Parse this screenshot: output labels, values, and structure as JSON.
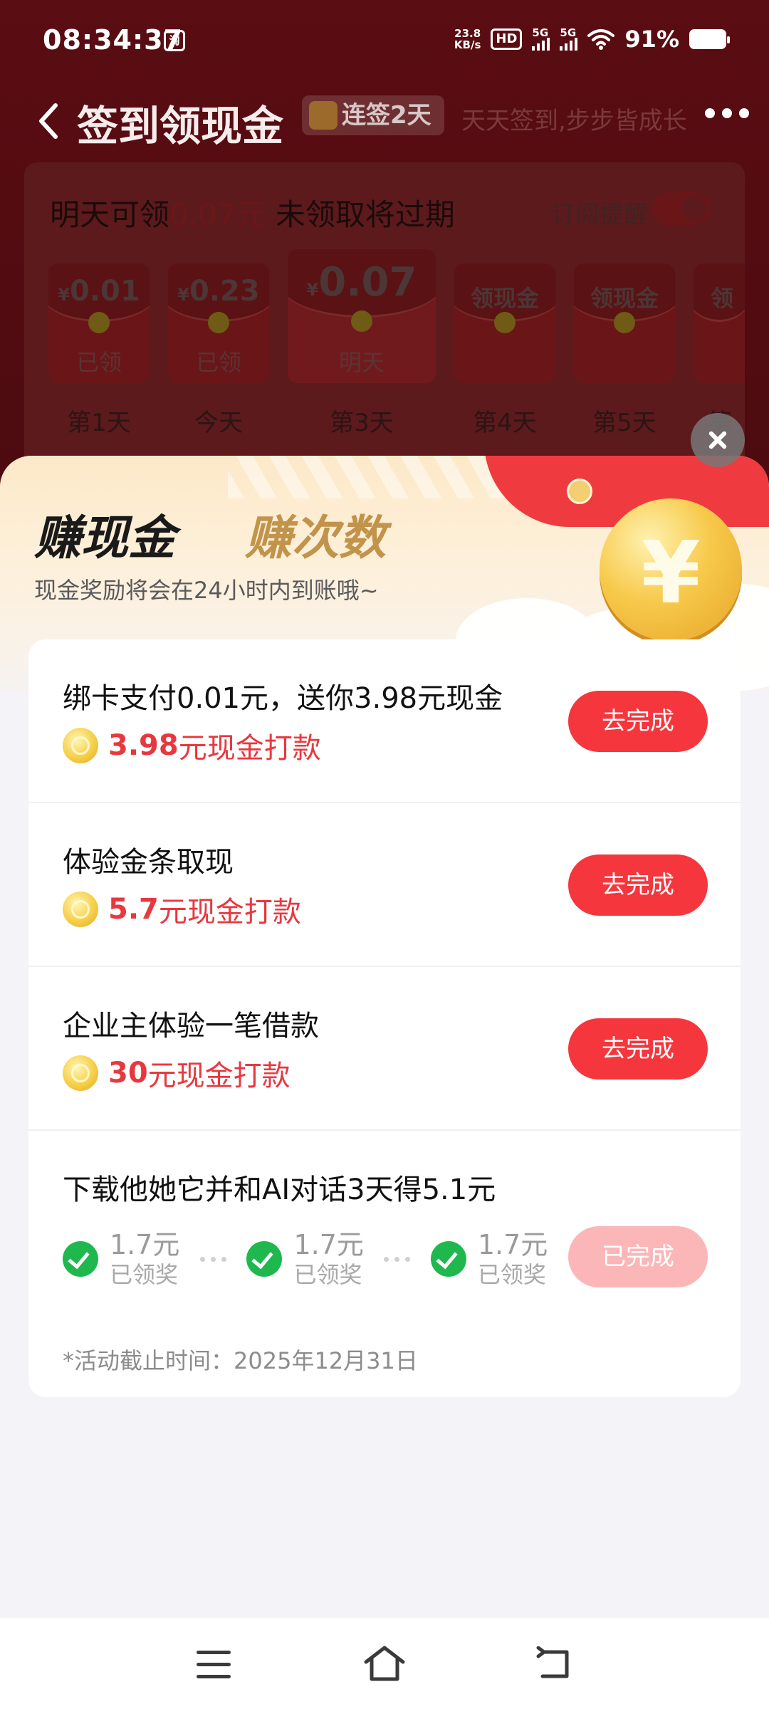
{
  "status_bar": {
    "time": "08:34:37",
    "app_badge": "淘",
    "net_speed_value": "23.8",
    "net_speed_unit": "KB/s",
    "hd_label": "HD",
    "sim1": "5G",
    "sim2": "5G",
    "battery": "91%"
  },
  "header": {
    "title": "签到领现金",
    "streak_badge": "连签2天",
    "slogan": "天天签到,步步皆成长"
  },
  "checkin": {
    "notice_prefix": "明天可领",
    "notice_amount": "0.07元",
    "notice_suffix": " 未领取将过期",
    "subscribe_label": "订阅提醒",
    "subscribe_on": true,
    "days": [
      {
        "amount": "0.01",
        "currency": "¥",
        "state": "已领",
        "label": "第1天"
      },
      {
        "amount": "0.23",
        "currency": "¥",
        "state": "已领",
        "label": "今天"
      },
      {
        "amount": "0.07",
        "currency": "¥",
        "state": "明天",
        "label": "第3天"
      },
      {
        "amount": "领现金",
        "currency": "",
        "state": "",
        "label": "第4天"
      },
      {
        "amount": "领现金",
        "currency": "",
        "state": "",
        "label": "第5天"
      },
      {
        "amount": "领",
        "currency": "",
        "state": "",
        "label": "第"
      }
    ]
  },
  "sheet": {
    "tab_active": "赚现金",
    "tab_inactive": "赚次数",
    "subtitle": "现金奖励将会在24小时内到账哦~",
    "coin_symbol": "¥",
    "tasks": [
      {
        "title": "绑卡支付0.01元，送你3.98元现金",
        "reward_amount": "3.98",
        "reward_unit": "元现金打款",
        "button": "去完成"
      },
      {
        "title": "体验金条取现",
        "reward_amount": "5.7",
        "reward_unit": "元现金打款",
        "button": "去完成"
      },
      {
        "title": "企业主体验一笔借款",
        "reward_amount": "30",
        "reward_unit": "元现金打款",
        "button": "去完成"
      }
    ],
    "multi_task": {
      "title": "下载他她它并和AI对话3天得5.1元",
      "steps": [
        {
          "value": "1.7元",
          "state": "已领奖"
        },
        {
          "value": "1.7元",
          "state": "已领奖"
        },
        {
          "value": "1.7元",
          "state": "已领奖"
        }
      ],
      "button": "已完成",
      "deadline": "*活动截止时间：2025年12月31日"
    }
  },
  "colors": {
    "accent_red": "#f5363d",
    "reward_red": "#e8383f",
    "done_button": "#fbb6b8",
    "check_green": "#1fb84e",
    "highlight_green": "#58e05b"
  }
}
